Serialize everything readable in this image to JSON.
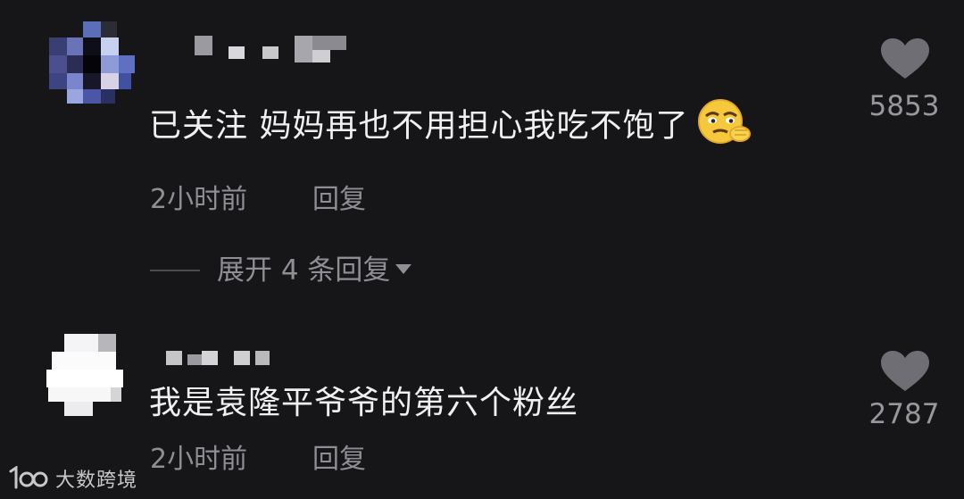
{
  "comments": [
    {
      "text": "已关注 妈妈再也不用担心我吃不饱了",
      "emoji": "smirk-emoji",
      "time": "2小时前",
      "reply_label": "回复",
      "likes": "5853",
      "expand_label": "展开 4 条回复"
    },
    {
      "text": "我是袁隆平爷爷的第六个粉丝",
      "time": "2小时前",
      "reply_label": "回复",
      "likes": "2787"
    }
  ],
  "watermark": {
    "logo_text": "100",
    "text": "大数跨境"
  },
  "colors": {
    "background": "#161619",
    "text_primary": "#f0f0f3",
    "text_secondary": "#8e8e95",
    "heart": "#6e6e74"
  }
}
